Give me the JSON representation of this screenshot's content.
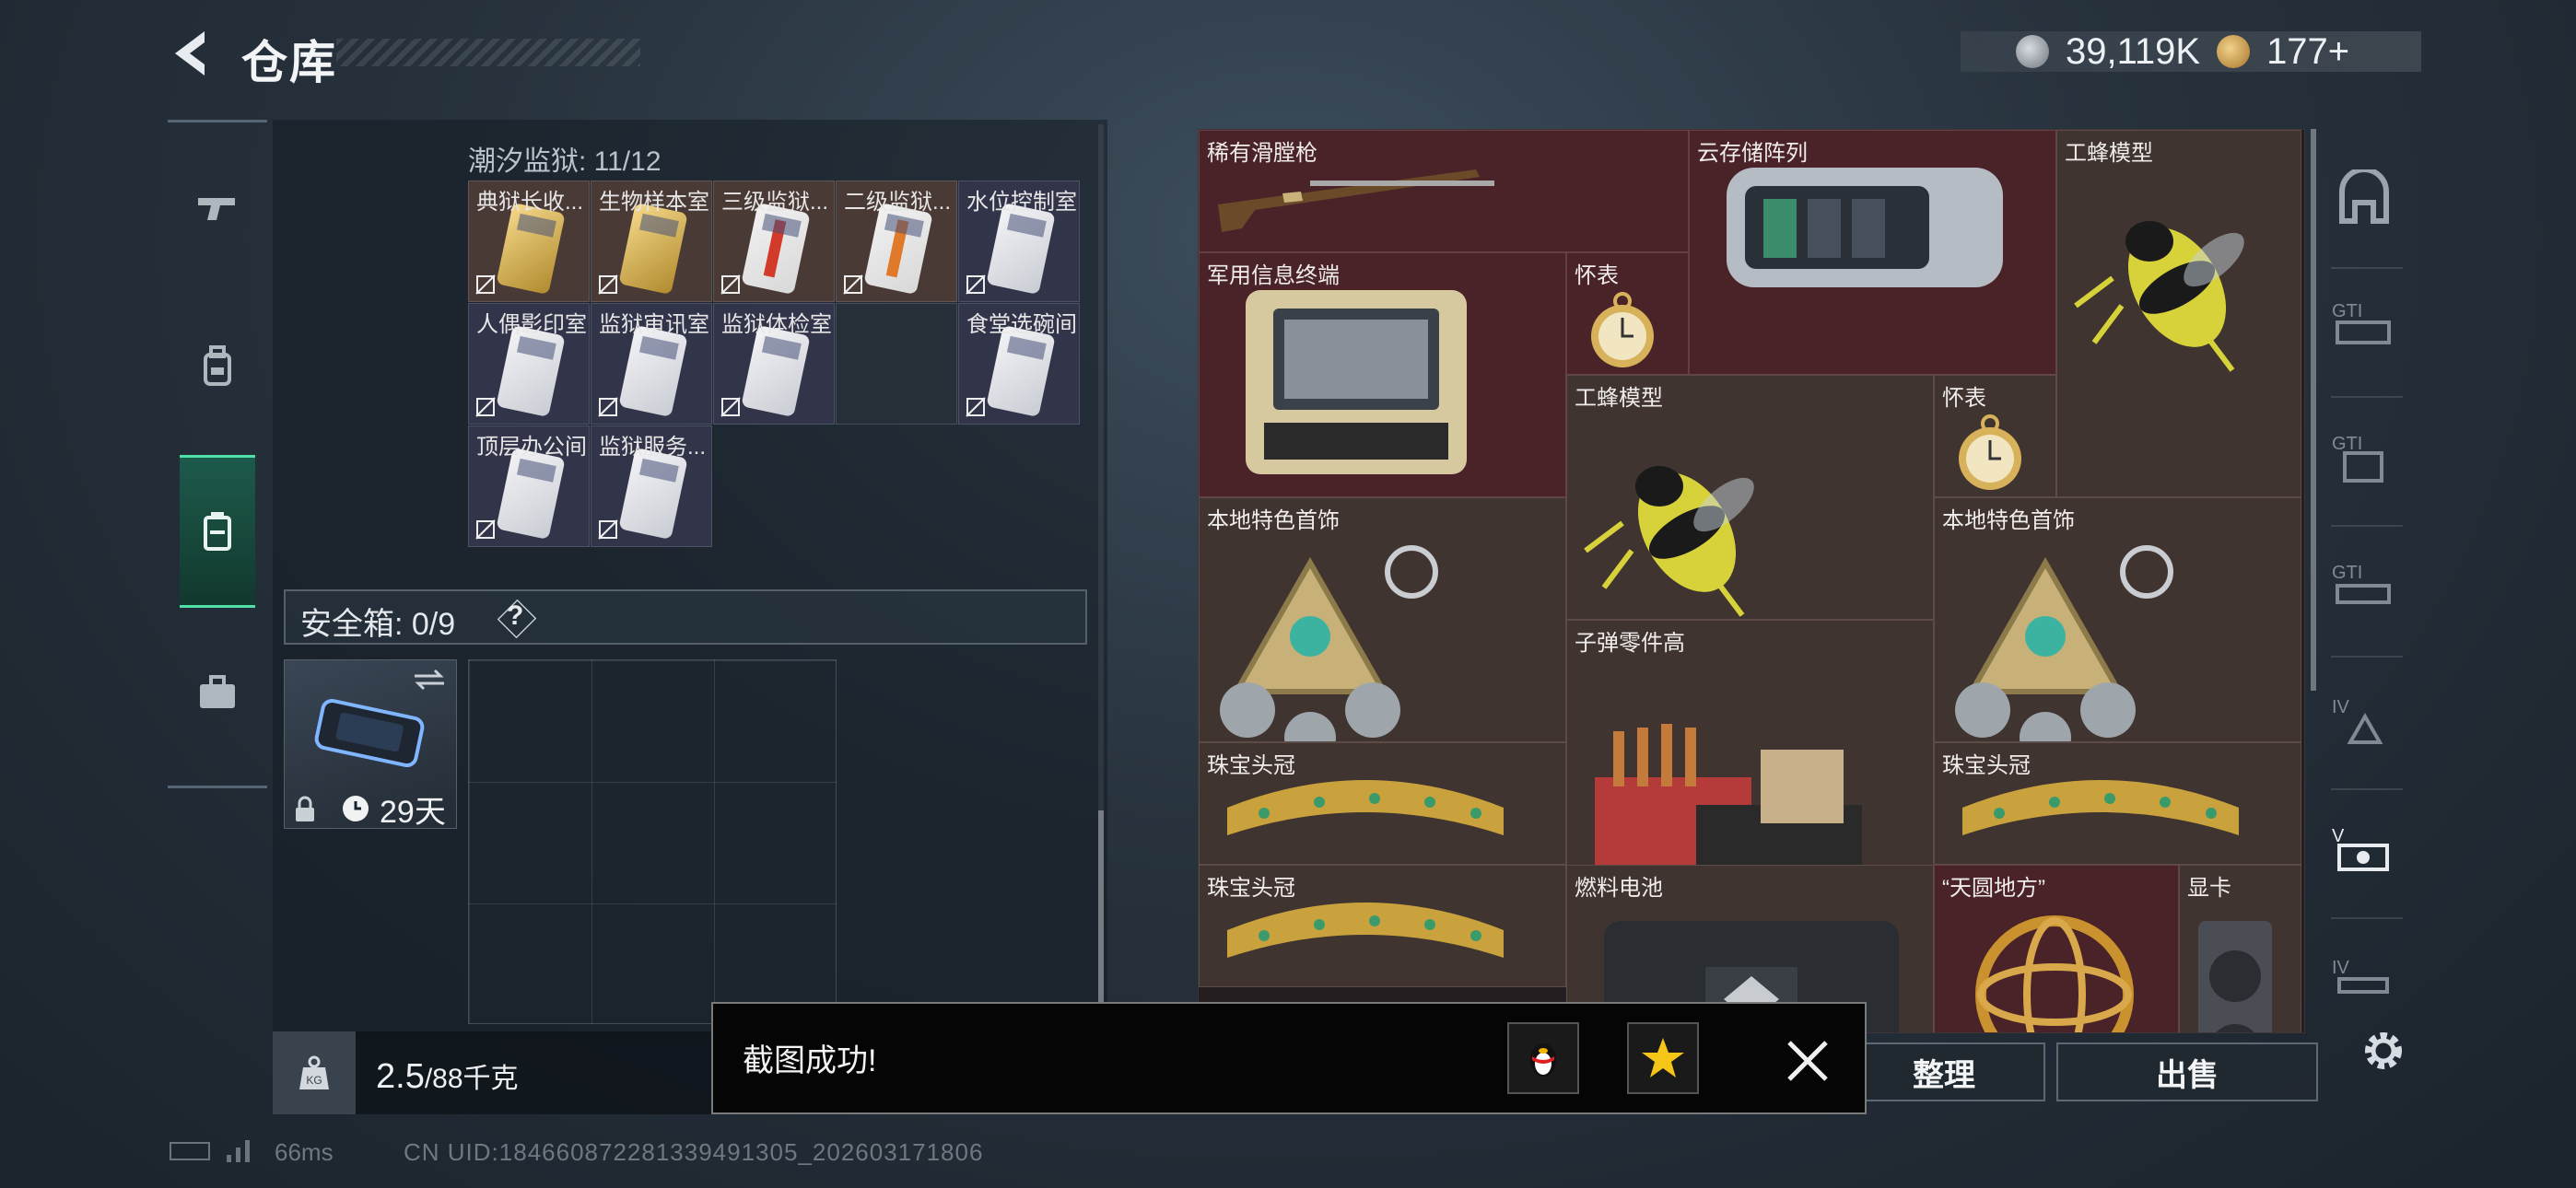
{
  "header": {
    "title": "仓库",
    "currency_primary": "39,119K",
    "currency_secondary": "177+"
  },
  "nav": {
    "items": [
      {
        "name": "weapons",
        "icon": "pistol-icon"
      },
      {
        "name": "gear",
        "icon": "backpack-icon"
      },
      {
        "name": "keycards",
        "icon": "keycard-icon",
        "active": true
      },
      {
        "name": "briefcase",
        "icon": "briefcase-icon"
      }
    ]
  },
  "left_panel": {
    "container_title": "潮汐监狱: 11/12",
    "keys": [
      {
        "label": "典狱长收...",
        "color": "gold"
      },
      {
        "label": "生物样本室",
        "color": "gold"
      },
      {
        "label": "三级监狱...",
        "color": "red"
      },
      {
        "label": "二级监狱...",
        "color": "orange"
      },
      {
        "label": "水位控制室",
        "color": "silver"
      },
      {
        "label": "人偶影印室",
        "color": "silver"
      },
      {
        "label": "监狱审讯室",
        "color": "silver"
      },
      {
        "label": "监狱体检室",
        "color": "silver"
      },
      {
        "label": "",
        "color": "empty"
      },
      {
        "label": "食堂选碗间",
        "color": "silver"
      },
      {
        "label": "顶层办公间",
        "color": "silver"
      },
      {
        "label": "监狱服务...",
        "color": "silver"
      }
    ],
    "safe_box_label": "安全箱: 0/9",
    "safe_box_help": "?",
    "safe_case_days": "29天",
    "weight_current": "2.5",
    "weight_max": "/88千克"
  },
  "stash": {
    "items": [
      {
        "name": "稀有滑膛枪",
        "art": "musket"
      },
      {
        "name": "云存储阵列",
        "art": "server"
      },
      {
        "name": "工蜂模型",
        "art": "bee"
      },
      {
        "name": "军用信息终端",
        "art": "terminal"
      },
      {
        "name": "怀表",
        "art": "watch"
      },
      {
        "name": "工蜂模型",
        "art": "bee"
      },
      {
        "name": "怀表",
        "art": "watch"
      },
      {
        "name": "本地特色首饰",
        "art": "jewel"
      },
      {
        "name": "本地特色首饰",
        "art": "jewel"
      },
      {
        "name": "子弹零件高",
        "art": "ammo"
      },
      {
        "name": "珠宝头冠",
        "art": "crown"
      },
      {
        "name": "珠宝头冠",
        "art": "crown"
      },
      {
        "name": "珠宝头冠",
        "art": "crown"
      },
      {
        "name": "燃料电池",
        "art": "battery"
      },
      {
        "name": "“天圆地方”",
        "art": "armillary"
      },
      {
        "name": "显卡",
        "art": "gpu"
      }
    ]
  },
  "buttons": {
    "sort": "整理",
    "sell": "出售"
  },
  "toast": {
    "message": "截图成功!"
  },
  "status": {
    "ping": "66ms",
    "uid": "CN UID:1846608722813394913​05_202603171806"
  },
  "colors": {
    "accent_green": "#4ee0a6",
    "stash_maroon": "#4a2328",
    "stash_brown": "#3f342f"
  }
}
